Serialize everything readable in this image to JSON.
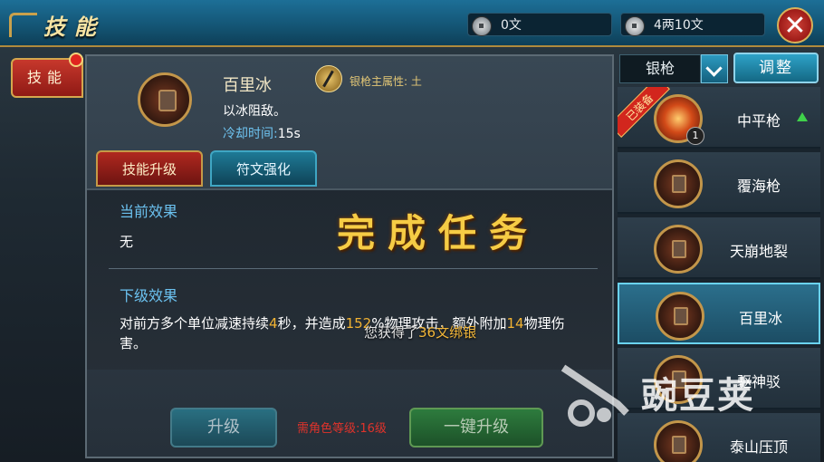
{
  "header": {
    "title": "技能",
    "currency_1": "0文",
    "currency_2": "4两10文",
    "close_glyph": "✕"
  },
  "left_tab": {
    "label": "技能"
  },
  "skill": {
    "name": "百里冰",
    "attribute": "银枪主属性: 土",
    "description": "以冰阻敌。",
    "cooldown_label": "冷却时间:",
    "cooldown_value": "15s"
  },
  "tabs": [
    {
      "label": "技能升级",
      "active": true
    },
    {
      "label": "符文强化",
      "active": false
    }
  ],
  "effects": {
    "current_title": "当前效果",
    "current_text": "无",
    "next_title": "下级效果",
    "next_text_parts": [
      "对前方多个单位减速持续",
      "4",
      "秒，并造成",
      "152",
      "%物理攻击，额外附加",
      "14",
      "物理伤害。"
    ]
  },
  "overlay": {
    "complete": "完成任务",
    "reward_prefix": "您获得了",
    "reward_value": "36文绑银"
  },
  "buttons": {
    "upgrade": "升级",
    "requirement": "需角色等级:16级",
    "one_click": "一键升级"
  },
  "right": {
    "weapon_select": "银枪",
    "adjust_label": "调整",
    "equipped_ribbon": "已装备",
    "items": [
      {
        "name": "中平枪",
        "level": "1",
        "selected": false
      },
      {
        "name": "覆海枪",
        "selected": false
      },
      {
        "name": "天崩地裂",
        "selected": false
      },
      {
        "name": "百里冰",
        "selected": true
      },
      {
        "name": "驱神驳",
        "selected": false
      },
      {
        "name": "泰山压顶",
        "selected": false
      }
    ]
  },
  "watermark": {
    "text": "豌豆荚"
  },
  "colors": {
    "accent_gold": "#f6cc45",
    "highlight": "#f2b333",
    "effect_title": "#6bc1ef"
  }
}
